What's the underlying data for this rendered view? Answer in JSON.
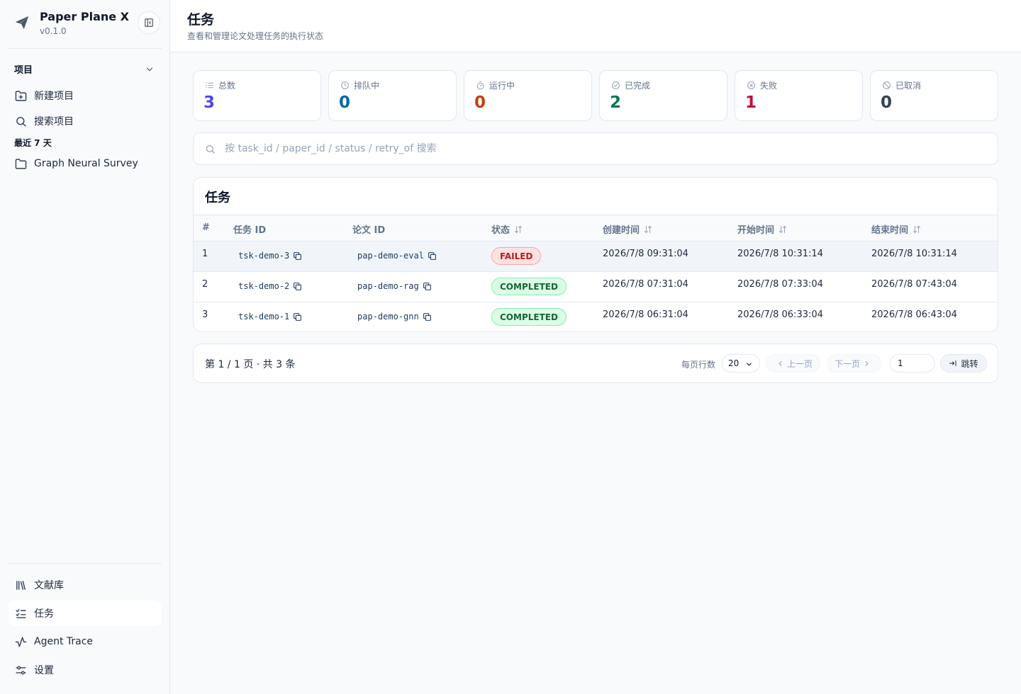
{
  "app": {
    "name": "Paper Plane X",
    "version": "v0.1.0"
  },
  "sidebar": {
    "section_label": "项目",
    "new_project": "新建项目",
    "search_project": "搜索项目",
    "recent_label": "最近 7 天",
    "recent_items": [
      {
        "label": "Graph Neural Survey"
      }
    ],
    "bottom_items": [
      {
        "label": "文献库",
        "icon": "library-icon"
      },
      {
        "label": "任务",
        "icon": "task-list-icon",
        "active": true
      },
      {
        "label": "Agent Trace",
        "icon": "activity-icon"
      },
      {
        "label": "设置",
        "icon": "settings-sliders-icon"
      }
    ]
  },
  "header": {
    "title": "任务",
    "subtitle": "查看和管理论文处理任务的执行状态"
  },
  "stats": [
    {
      "label": "总数",
      "value": "3",
      "color": "#4f46e5",
      "icon": "list-icon"
    },
    {
      "label": "排队中",
      "value": "0",
      "color": "#0369a1",
      "icon": "clock-icon"
    },
    {
      "label": "运行中",
      "value": "0",
      "color": "#c2410c",
      "icon": "timer-icon"
    },
    {
      "label": "已完成",
      "value": "2",
      "color": "#047857",
      "icon": "check-circle-icon"
    },
    {
      "label": "失败",
      "value": "1",
      "color": "#be123c",
      "icon": "x-circle-icon"
    },
    {
      "label": "已取消",
      "value": "0",
      "color": "#334155",
      "icon": "ban-icon"
    }
  ],
  "search": {
    "placeholder": "按 task_id / paper_id / status / retry_of 搜索"
  },
  "table": {
    "title": "任务",
    "columns": [
      "#",
      "任务 ID",
      "论文 ID",
      "状态",
      "创建时间",
      "开始时间",
      "结束时间"
    ],
    "rows": [
      {
        "idx": "1",
        "task_id": "tsk-demo-3",
        "paper_id": "pap-demo-eval",
        "status": "FAILED",
        "created": "2026/7/8 09:31:04",
        "started": "2026/7/8 10:31:14",
        "ended": "2026/7/8 10:31:14"
      },
      {
        "idx": "2",
        "task_id": "tsk-demo-2",
        "paper_id": "pap-demo-rag",
        "status": "COMPLETED",
        "created": "2026/7/8 07:31:04",
        "started": "2026/7/8 07:33:04",
        "ended": "2026/7/8 07:43:04"
      },
      {
        "idx": "3",
        "task_id": "tsk-demo-1",
        "paper_id": "pap-demo-gnn",
        "status": "COMPLETED",
        "created": "2026/7/8 06:31:04",
        "started": "2026/7/8 06:33:04",
        "ended": "2026/7/8 06:43:04"
      }
    ]
  },
  "pagination": {
    "info": "第 1 / 1 页 · 共 3 条",
    "rows_per_page_label": "每页行数",
    "rows_per_page": "20",
    "prev": "上一页",
    "next": "下一页",
    "page_input": "1",
    "jump": "跳转"
  }
}
